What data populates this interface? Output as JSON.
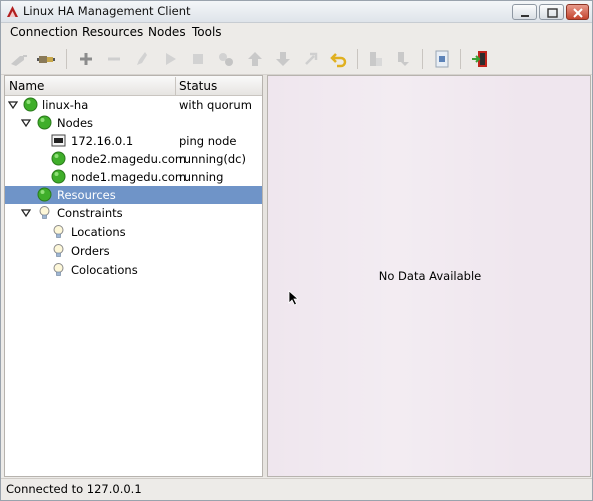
{
  "window": {
    "title": "Linux HA Management Client"
  },
  "menubar": {
    "items": [
      "Connection",
      "Resources",
      "Nodes",
      "Tools"
    ]
  },
  "toolbar": {
    "icons": [
      "disconnect-icon",
      "connect-icon",
      "add-icon",
      "remove-icon",
      "cleanup-icon",
      "start-icon",
      "stop-icon",
      "migrate-icon",
      "move-up-icon",
      "move-down-icon",
      "default-icon",
      "undo-icon",
      "standby-icon",
      "active-icon",
      "view-xml-icon",
      "exit-icon"
    ]
  },
  "tree": {
    "header": {
      "name": "Name",
      "status": "Status"
    },
    "rows": [
      {
        "label": "linux-ha",
        "status": "with quorum",
        "icon": "green-status-icon"
      },
      {
        "label": "Nodes",
        "status": "",
        "icon": "green-status-icon"
      },
      {
        "label": "172.16.0.1",
        "status": "ping node",
        "icon": "ping-node-icon"
      },
      {
        "label": "node2.magedu.com",
        "status": "running(dc)",
        "icon": "green-status-icon"
      },
      {
        "label": "node1.magedu.com",
        "status": "running",
        "icon": "green-status-icon"
      },
      {
        "label": "Resources",
        "status": "",
        "icon": "green-status-icon"
      },
      {
        "label": "Constraints",
        "status": "",
        "icon": "lightbulb-icon"
      },
      {
        "label": "Locations",
        "status": "",
        "icon": "lightbulb-icon"
      },
      {
        "label": "Orders",
        "status": "",
        "icon": "lightbulb-icon"
      },
      {
        "label": "Colocations",
        "status": "",
        "icon": "lightbulb-icon"
      }
    ]
  },
  "detail": {
    "message": "No Data Available"
  },
  "status": {
    "text": "Connected to 127.0.0.1"
  },
  "colors": {
    "selection": "#6f94c8",
    "status_green": "#3fae2a",
    "panel_bg": "#efe6ee"
  }
}
